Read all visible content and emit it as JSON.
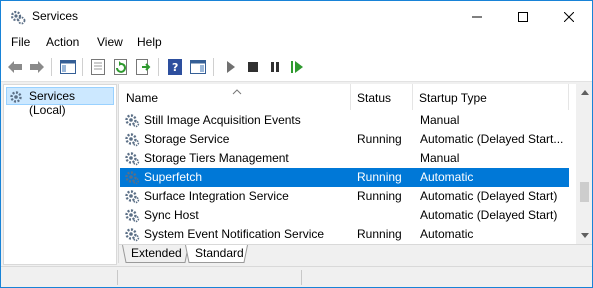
{
  "window": {
    "title": "Services",
    "icon": "gear-icon"
  },
  "caption_buttons": {
    "minimize": "minimize-icon",
    "maximize": "maximize-icon",
    "close": "close-icon"
  },
  "menu": [
    "File",
    "Action",
    "View",
    "Help"
  ],
  "toolbar": {
    "buttons": [
      "back-icon",
      "forward-icon",
      "show-hide-console-tree-icon",
      "properties-icon",
      "refresh-icon",
      "export-list-icon",
      "help-icon",
      "show-hide-action-pane-icon",
      "start-service-icon",
      "stop-service-icon",
      "pause-service-icon",
      "restart-service-icon"
    ]
  },
  "tree": {
    "items": [
      {
        "label": "Services (Local)",
        "icon": "services-icon"
      }
    ]
  },
  "list": {
    "columns": [
      "Name",
      "Status",
      "Startup Type"
    ],
    "sort_indicator": "^",
    "rows": [
      {
        "name": "Still Image Acquisition Events",
        "status": "",
        "startup": "Manual",
        "selected": false
      },
      {
        "name": "Storage Service",
        "status": "Running",
        "startup": "Automatic (Delayed Start...",
        "selected": false
      },
      {
        "name": "Storage Tiers Management",
        "status": "",
        "startup": "Manual",
        "selected": false
      },
      {
        "name": "Superfetch",
        "status": "Running",
        "startup": "Automatic",
        "selected": true
      },
      {
        "name": "Surface Integration Service",
        "status": "Running",
        "startup": "Automatic (Delayed Start)",
        "selected": false
      },
      {
        "name": "Sync Host",
        "status": "",
        "startup": "Automatic (Delayed Start)",
        "selected": false
      },
      {
        "name": "System Event Notification Service",
        "status": "Running",
        "startup": "Automatic",
        "selected": false
      }
    ]
  },
  "tabs": [
    "Extended",
    "Standard"
  ],
  "colors": {
    "selection": "#0078d7",
    "accent_border": "#1883d7",
    "tree_selection": "#cce8ff"
  }
}
